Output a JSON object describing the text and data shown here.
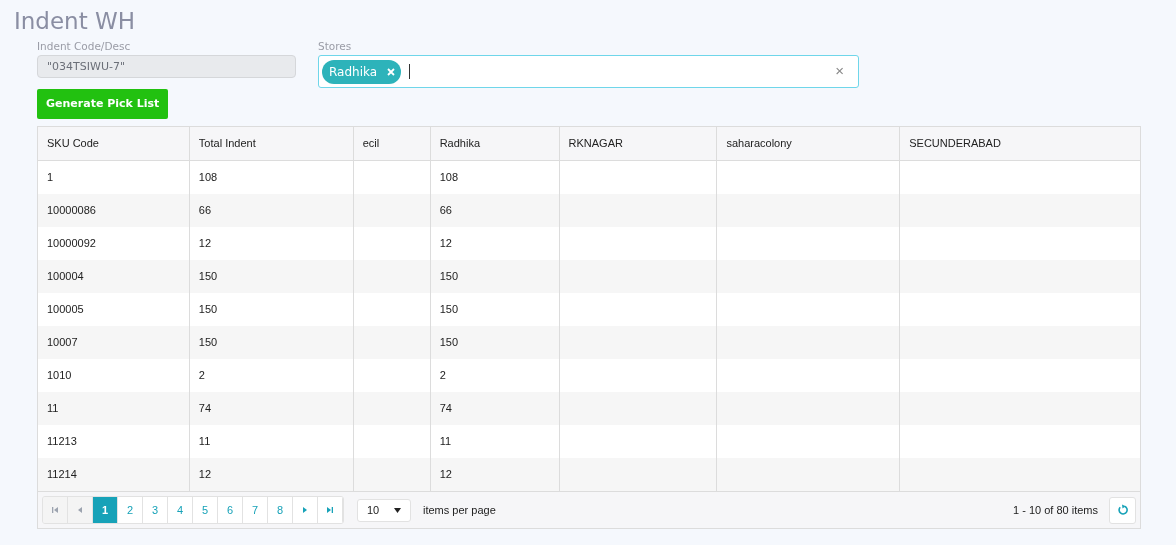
{
  "title": "Indent WH",
  "indent_field": {
    "label": "Indent Code/Desc",
    "value": "\"034TSIWU-7\"",
    "disabled": true
  },
  "stores_field": {
    "label": "Stores",
    "tags": [
      "Radhika"
    ],
    "clear": "×"
  },
  "generate_button": "Generate Pick List",
  "table": {
    "columns": [
      "SKU Code",
      "Total Indent",
      "ecil",
      "Radhika",
      "RKNAGAR",
      "saharacolony",
      "SECUNDERABAD"
    ],
    "rows": [
      {
        "cells": [
          "1",
          "108",
          null,
          "108",
          null,
          null,
          null
        ]
      },
      {
        "cells": [
          "10000086",
          "66",
          null,
          "66",
          null,
          null,
          null
        ]
      },
      {
        "cells": [
          "10000092",
          "12",
          null,
          "12",
          null,
          null,
          null
        ]
      },
      {
        "cells": [
          "100004",
          "150",
          null,
          "150",
          null,
          null,
          null
        ]
      },
      {
        "cells": [
          "100005",
          "150",
          null,
          "150",
          null,
          null,
          null
        ]
      },
      {
        "cells": [
          "10007",
          "150",
          null,
          "150",
          null,
          null,
          null
        ]
      },
      {
        "cells": [
          "1010",
          "2",
          null,
          "2",
          null,
          null,
          null
        ]
      },
      {
        "cells": [
          "11",
          "74",
          null,
          "74",
          null,
          null,
          null
        ]
      },
      {
        "cells": [
          "11213",
          "11",
          null,
          "11",
          null,
          null,
          null
        ]
      },
      {
        "cells": [
          "11214",
          "12",
          null,
          "12",
          null,
          null,
          null
        ]
      }
    ]
  },
  "pager": {
    "nav_start": [
      {
        "kind": "first",
        "disabled": true
      },
      {
        "kind": "prev",
        "disabled": true
      }
    ],
    "pages": [
      {
        "label": "1",
        "selected": true
      },
      {
        "label": "2",
        "selected": false
      },
      {
        "label": "3",
        "selected": false
      },
      {
        "label": "4",
        "selected": false
      },
      {
        "label": "5",
        "selected": false
      },
      {
        "label": "6",
        "selected": false
      },
      {
        "label": "7",
        "selected": false
      },
      {
        "label": "8",
        "selected": false
      }
    ],
    "nav_end": [
      {
        "kind": "next",
        "disabled": false
      },
      {
        "kind": "last",
        "disabled": false
      }
    ],
    "page_size": "10",
    "page_size_label": "items per page",
    "summary": "1 - 10 of 80 items"
  }
}
